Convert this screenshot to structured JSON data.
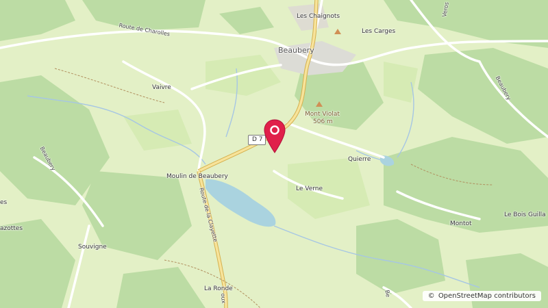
{
  "map": {
    "places": {
      "beaubery": "Beaubery",
      "les_chaignots": "Les Chaignots",
      "les_carges": "Les Carges",
      "vaivre": "Vaivre",
      "mont_violat": "Mont Violat",
      "mont_violat_elevation": "506 m",
      "quierre": "Quierre",
      "moulin_de_beaubery": "Moulin de Beaubery",
      "le_verne": "Le Verne",
      "montot": "Montot",
      "le_bois_guilla": "Le Bois Guilla",
      "souvigne": "Souvigne",
      "la_ronde": "La Ronde",
      "lazottes": "azottes",
      "left_es": "es",
      "beaubery_west": "Beaubery"
    },
    "roads": {
      "route_de_charolles": "Route de Charolles",
      "route_de_la_clayette": "Route de la Clayette",
      "d_road_shield": "D 7",
      "beaubery_road_east": "Beaubery",
      "veros_road": "Veros",
      "bottom_road_b": "Be",
      "bottom_road_x": "oux"
    },
    "marker": {
      "label": "Location marker",
      "color": "#e0204a"
    },
    "attribution": {
      "symbol": "©",
      "text": "OpenStreetMap contributors"
    }
  }
}
